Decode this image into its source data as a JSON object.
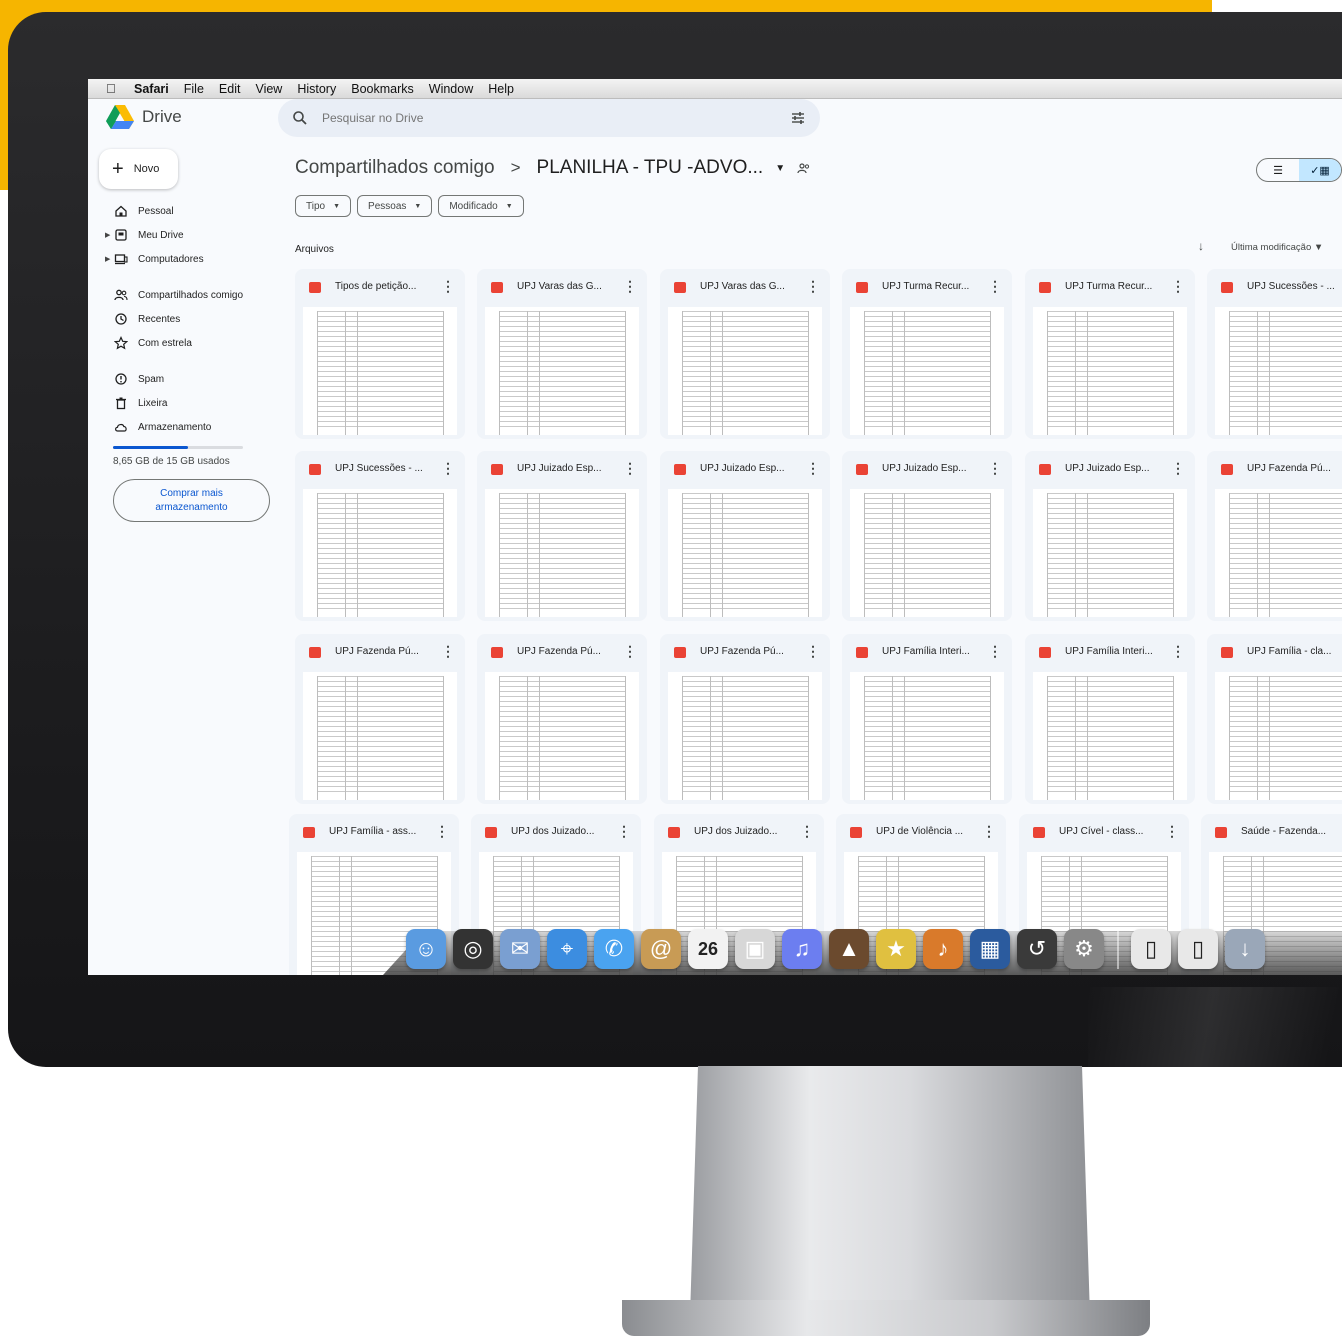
{
  "menubar": {
    "app": "Safari",
    "items": [
      "File",
      "Edit",
      "View",
      "History",
      "Bookmarks",
      "Window",
      "Help"
    ]
  },
  "drive": {
    "logo_text": "Drive",
    "search_placeholder": "Pesquisar no Drive"
  },
  "sidebar": {
    "new_label": "Novo",
    "items": [
      {
        "label": "Pessoal",
        "icon": "home-icon"
      },
      {
        "label": "Meu Drive",
        "icon": "drive-icon"
      },
      {
        "label": "Computadores",
        "icon": "computer-icon"
      },
      {
        "label": "Compartilhados comigo",
        "icon": "people-icon"
      },
      {
        "label": "Recentes",
        "icon": "clock-icon"
      },
      {
        "label": "Com estrela",
        "icon": "star-icon"
      },
      {
        "label": "Spam",
        "icon": "spam-icon"
      },
      {
        "label": "Lixeira",
        "icon": "trash-icon"
      },
      {
        "label": "Armazenamento",
        "icon": "cloud-icon"
      }
    ],
    "storage_text": "8,65 GB de 15 GB usados",
    "storage_fraction": 0.577,
    "buy_line1": "Comprar mais",
    "buy_line2": "armazenamento"
  },
  "main": {
    "breadcrumb_root": "Compartilhados comigo",
    "breadcrumb_sep": ">",
    "breadcrumb_current": "PLANILHA - TPU -ADVO...",
    "filters": [
      "Tipo",
      "Pessoas",
      "Modificado"
    ],
    "section_label": "Arquivos",
    "sort_label": "Última modificação"
  },
  "files": [
    "Tipos de petição...",
    "UPJ Varas das G...",
    "UPJ Varas das G...",
    "UPJ Turma Recur...",
    "UPJ Turma Recur...",
    "UPJ Sucessões - ...",
    "UPJ Sucessões - ...",
    "UPJ Juizado Esp...",
    "UPJ Juizado Esp...",
    "UPJ Juizado Esp...",
    "UPJ Juizado Esp...",
    "UPJ Fazenda Pú...",
    "UPJ Fazenda Pú...",
    "UPJ Fazenda Pú...",
    "UPJ Fazenda Pú...",
    "UPJ Família Interi...",
    "UPJ Família Interi...",
    "UPJ Família - cla...",
    "UPJ Família - ass...",
    "UPJ dos Juizado...",
    "UPJ dos Juizado...",
    "UPJ de Violência ...",
    "UPJ Cível - class...",
    "Saúde - Fazenda..."
  ],
  "dock": [
    "finder-icon",
    "dashboard-icon",
    "mail-stamp-icon",
    "safari-icon",
    "ichat-icon",
    "address-book-icon",
    "ical-icon",
    "preview-icon",
    "itunes-icon",
    "iphoto-icon",
    "imovie-icon",
    "garageband-icon",
    "spaces-icon",
    "time-machine-icon",
    "system-preferences-icon",
    "pdf-doc-icon",
    "pdf-doc-icon",
    "downloads-icon"
  ],
  "dock_calendar_day": "26",
  "colors": {
    "accent": "#0b57d0",
    "pdf": "#ea4335",
    "brand_yellow": "#f6b500"
  }
}
